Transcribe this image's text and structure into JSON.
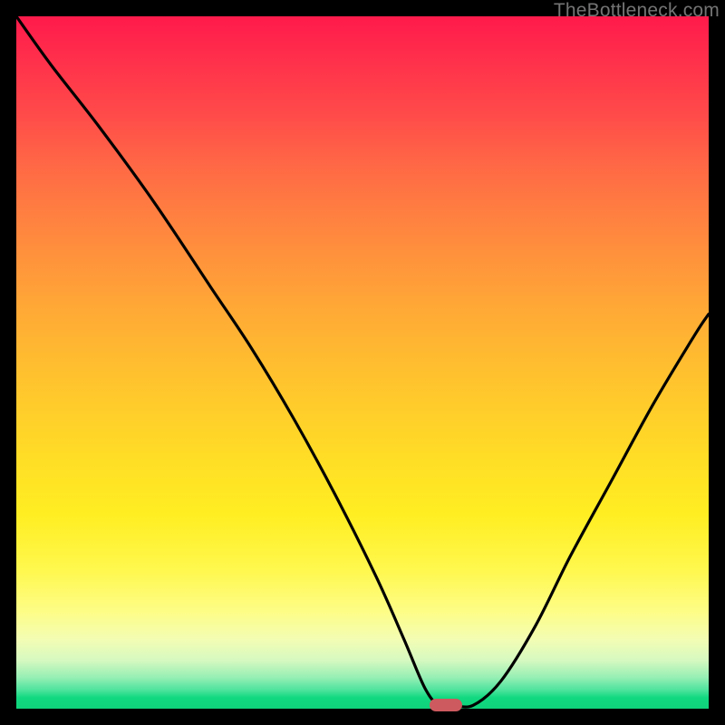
{
  "watermark": "TheBottleneck.com",
  "colors": {
    "background": "#000000",
    "curve": "#000000",
    "marker": "#cc5a5f",
    "gradient_top": "#ff1a4b",
    "gradient_bottom": "#0fd37a"
  },
  "chart_data": {
    "type": "line",
    "title": "",
    "xlabel": "",
    "ylabel": "",
    "xlim": [
      0,
      100
    ],
    "ylim": [
      0,
      100
    ],
    "grid": false,
    "legend": false,
    "axes_visible": false,
    "note": "Axis ticks and labels are not rendered in the image; values are estimated as percentages of the plot area. y=0 at bottom (green), y=100 at top (red).",
    "series": [
      {
        "name": "bottleneck-curve",
        "x": [
          0,
          5,
          12,
          20,
          28,
          34,
          40,
          46,
          52,
          56,
          59,
          61,
          63,
          66,
          70,
          75,
          80,
          86,
          92,
          98,
          100
        ],
        "y": [
          100,
          93,
          84,
          73,
          61,
          52,
          42,
          31,
          19,
          10,
          3,
          0.5,
          0.5,
          0.5,
          4,
          12,
          22,
          33,
          44,
          54,
          57
        ]
      }
    ],
    "marker": {
      "name": "optimal-point",
      "x": 62,
      "y": 0.5,
      "shape": "rounded-bar",
      "color": "#cc5a5f"
    }
  }
}
